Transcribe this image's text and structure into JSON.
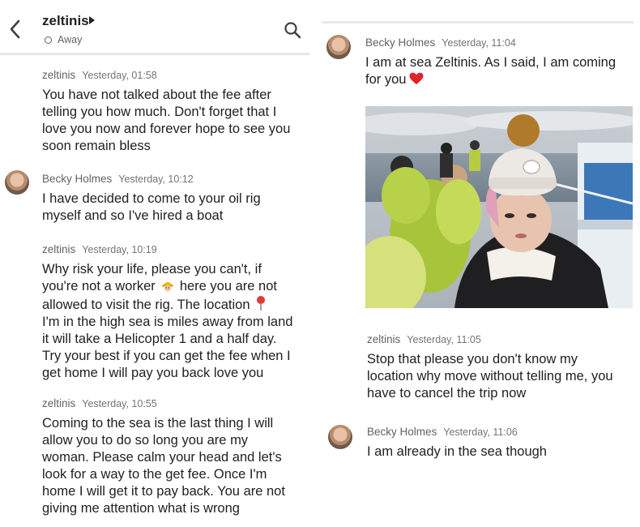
{
  "header": {
    "contact_name": "zeltinis",
    "status": "Away"
  },
  "left_messages": [
    {
      "sender": "zeltinis",
      "time": "Yesterday, 01:58",
      "lines": [
        "You have not talked about the fee after",
        "telling you how much.  Don't forget that I",
        "love you now and forever hope to see you",
        "soon remain bless"
      ]
    },
    {
      "sender": "Becky Holmes",
      "time": "Yesterday, 10:12",
      "lines": [
        "I have decided to come to your oil rig",
        "myself and so I've hired a boat"
      ]
    },
    {
      "sender": "zeltinis",
      "time": "Yesterday, 10:19",
      "lines": [
        "Why risk your life, please you can't, if",
        "you're not a worker",
        "here you are not",
        "allowed to visit the rig. The location",
        "I'm in the high sea is miles away from land",
        "it will take a Helicopter 1 and a half day.",
        "Try your best if you can get the fee when I",
        "get home I will pay you back love you"
      ]
    },
    {
      "sender": "zeltinis",
      "time": "Yesterday, 10:55",
      "lines": [
        "Coming to the sea is the last thing I will",
        "allow you to do so long you are my",
        "woman.  Please calm your head and let's",
        "look for a way to the get fee. Once I'm",
        "home I will get it to pay back.  You are not",
        "giving me attention what is wrong"
      ]
    }
  ],
  "right_messages": [
    {
      "sender": "Becky Holmes",
      "time": "Yesterday, 11:04",
      "lines": [
        "I am at sea Zeltinis. As I said, I am coming",
        "for you"
      ]
    },
    {
      "sender": "zeltinis",
      "time": "Yesterday, 11:05",
      "lines": [
        "Stop that please you don't know my",
        "location why move without telling me, you",
        "have to cancel the trip now"
      ]
    },
    {
      "sender": "Becky Holmes",
      "time": "Yesterday, 11:06",
      "lines": [
        "I am already in the sea though"
      ]
    }
  ],
  "icons": {
    "back": "chevron-left-icon",
    "search": "search-icon",
    "worker": "construction-worker-emoji",
    "location": "round-pushpin-emoji",
    "heart": "red-heart-emoji"
  },
  "colors": {
    "heart": "#e0242a",
    "pin": "#e53935",
    "text": "#202124",
    "meta": "#5f6368"
  }
}
